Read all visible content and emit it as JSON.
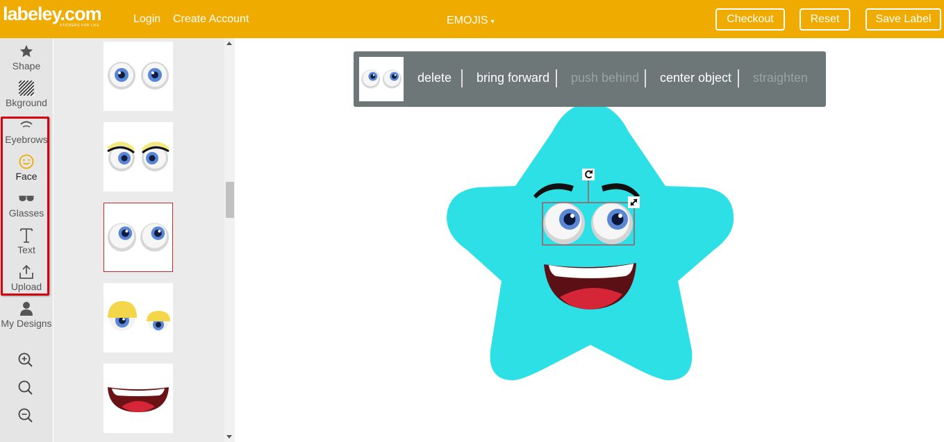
{
  "brand": {
    "name": "labeley.com",
    "tagline": "STICKERS FOR LIFE"
  },
  "nav": {
    "login": "Login",
    "create_account": "Create Account",
    "category": "EMOJIS",
    "category_caret": "▾"
  },
  "actions": {
    "checkout": "Checkout",
    "reset": "Reset",
    "save_label": "Save Label"
  },
  "tools": [
    {
      "label": "Shape",
      "icon": "star-icon"
    },
    {
      "label": "Bkground",
      "icon": "background-pattern-icon"
    },
    {
      "label": "Eyebrows",
      "icon": "eyebrow-icon"
    },
    {
      "label": "Face",
      "icon": "smiley-face-icon"
    },
    {
      "label": "Glasses",
      "icon": "glasses-icon"
    },
    {
      "label": "Text",
      "icon": "text-t-icon"
    },
    {
      "label": "Upload",
      "icon": "upload-icon"
    },
    {
      "label": "My Designs",
      "icon": "user-icon"
    }
  ],
  "zoom_controls": [
    "zoom-in-icon",
    "zoom-reset-icon",
    "zoom-out-icon"
  ],
  "object_toolbar": {
    "delete": "delete",
    "bring_forward": "bring forward",
    "push_behind": "push behind",
    "center_object": "center object",
    "straighten": "straighten"
  },
  "panel_items": [
    "eyes-round",
    "eyes-yellow-brows",
    "eyes-looking-up",
    "eyes-sleepy-yellow-lids",
    "mouth-open-smile"
  ],
  "selected_panel_item": 2,
  "colors": {
    "header": "#f0ab00",
    "star": "#2de0e6",
    "highlight": "#d8000a",
    "selection": "#c9262c",
    "toolbar": "#6d7778"
  }
}
